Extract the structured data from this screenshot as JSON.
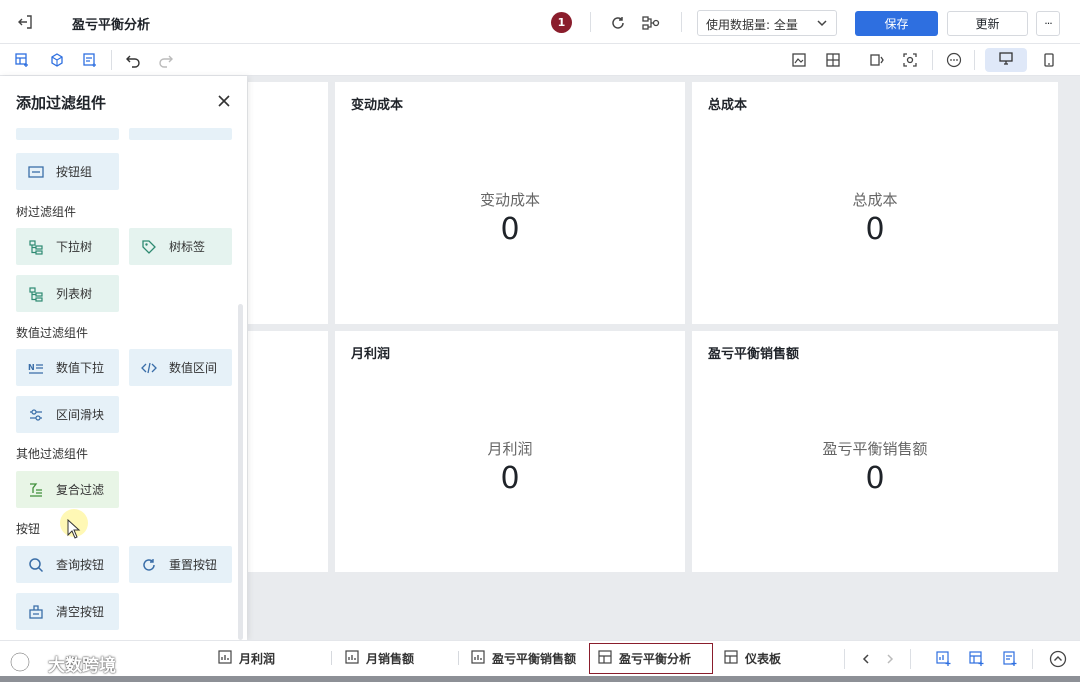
{
  "header": {
    "title": "盈亏平衡分析",
    "notification_count": "1",
    "data_usage_label": "使用数据量: 全量",
    "save_label": "保存",
    "update_label": "更新",
    "more_label": "···"
  },
  "filter_panel": {
    "title": "添加过滤组件",
    "sections": {
      "tree": "树过滤组件",
      "numeric": "数值过滤组件",
      "other": "其他过滤组件",
      "button": "按钮"
    },
    "items": {
      "button_group": "按钮组",
      "dropdown_tree": "下拉树",
      "tree_tag": "树标签",
      "list_tree": "列表树",
      "numeric_dropdown": "数值下拉",
      "numeric_range": "数值区间",
      "range_slider": "区间滑块",
      "compound_filter": "复合过滤",
      "query_button": "查询按钮",
      "reset_button": "重置按钮",
      "clear_button": "清空按钮"
    }
  },
  "cards": [
    {
      "title": "变动成本",
      "label": "变动成本",
      "value": "0"
    },
    {
      "title": "总成本",
      "label": "总成本",
      "value": "0"
    },
    {
      "title": "月利润",
      "label": "月利润",
      "value": "0"
    },
    {
      "title": "盈亏平衡销售额",
      "label": "盈亏平衡销售额",
      "value": "0"
    }
  ],
  "bottom_tabs": [
    {
      "label": "月利润"
    },
    {
      "label": "月销售额"
    },
    {
      "label": "盈亏平衡销售额"
    },
    {
      "label": "盈亏平衡分析",
      "active": true
    },
    {
      "label": "仪表板"
    }
  ],
  "watermark": {
    "text": "大数跨境"
  },
  "colors": {
    "primary": "#2e6fe0",
    "accent": "#8a1d2c"
  }
}
